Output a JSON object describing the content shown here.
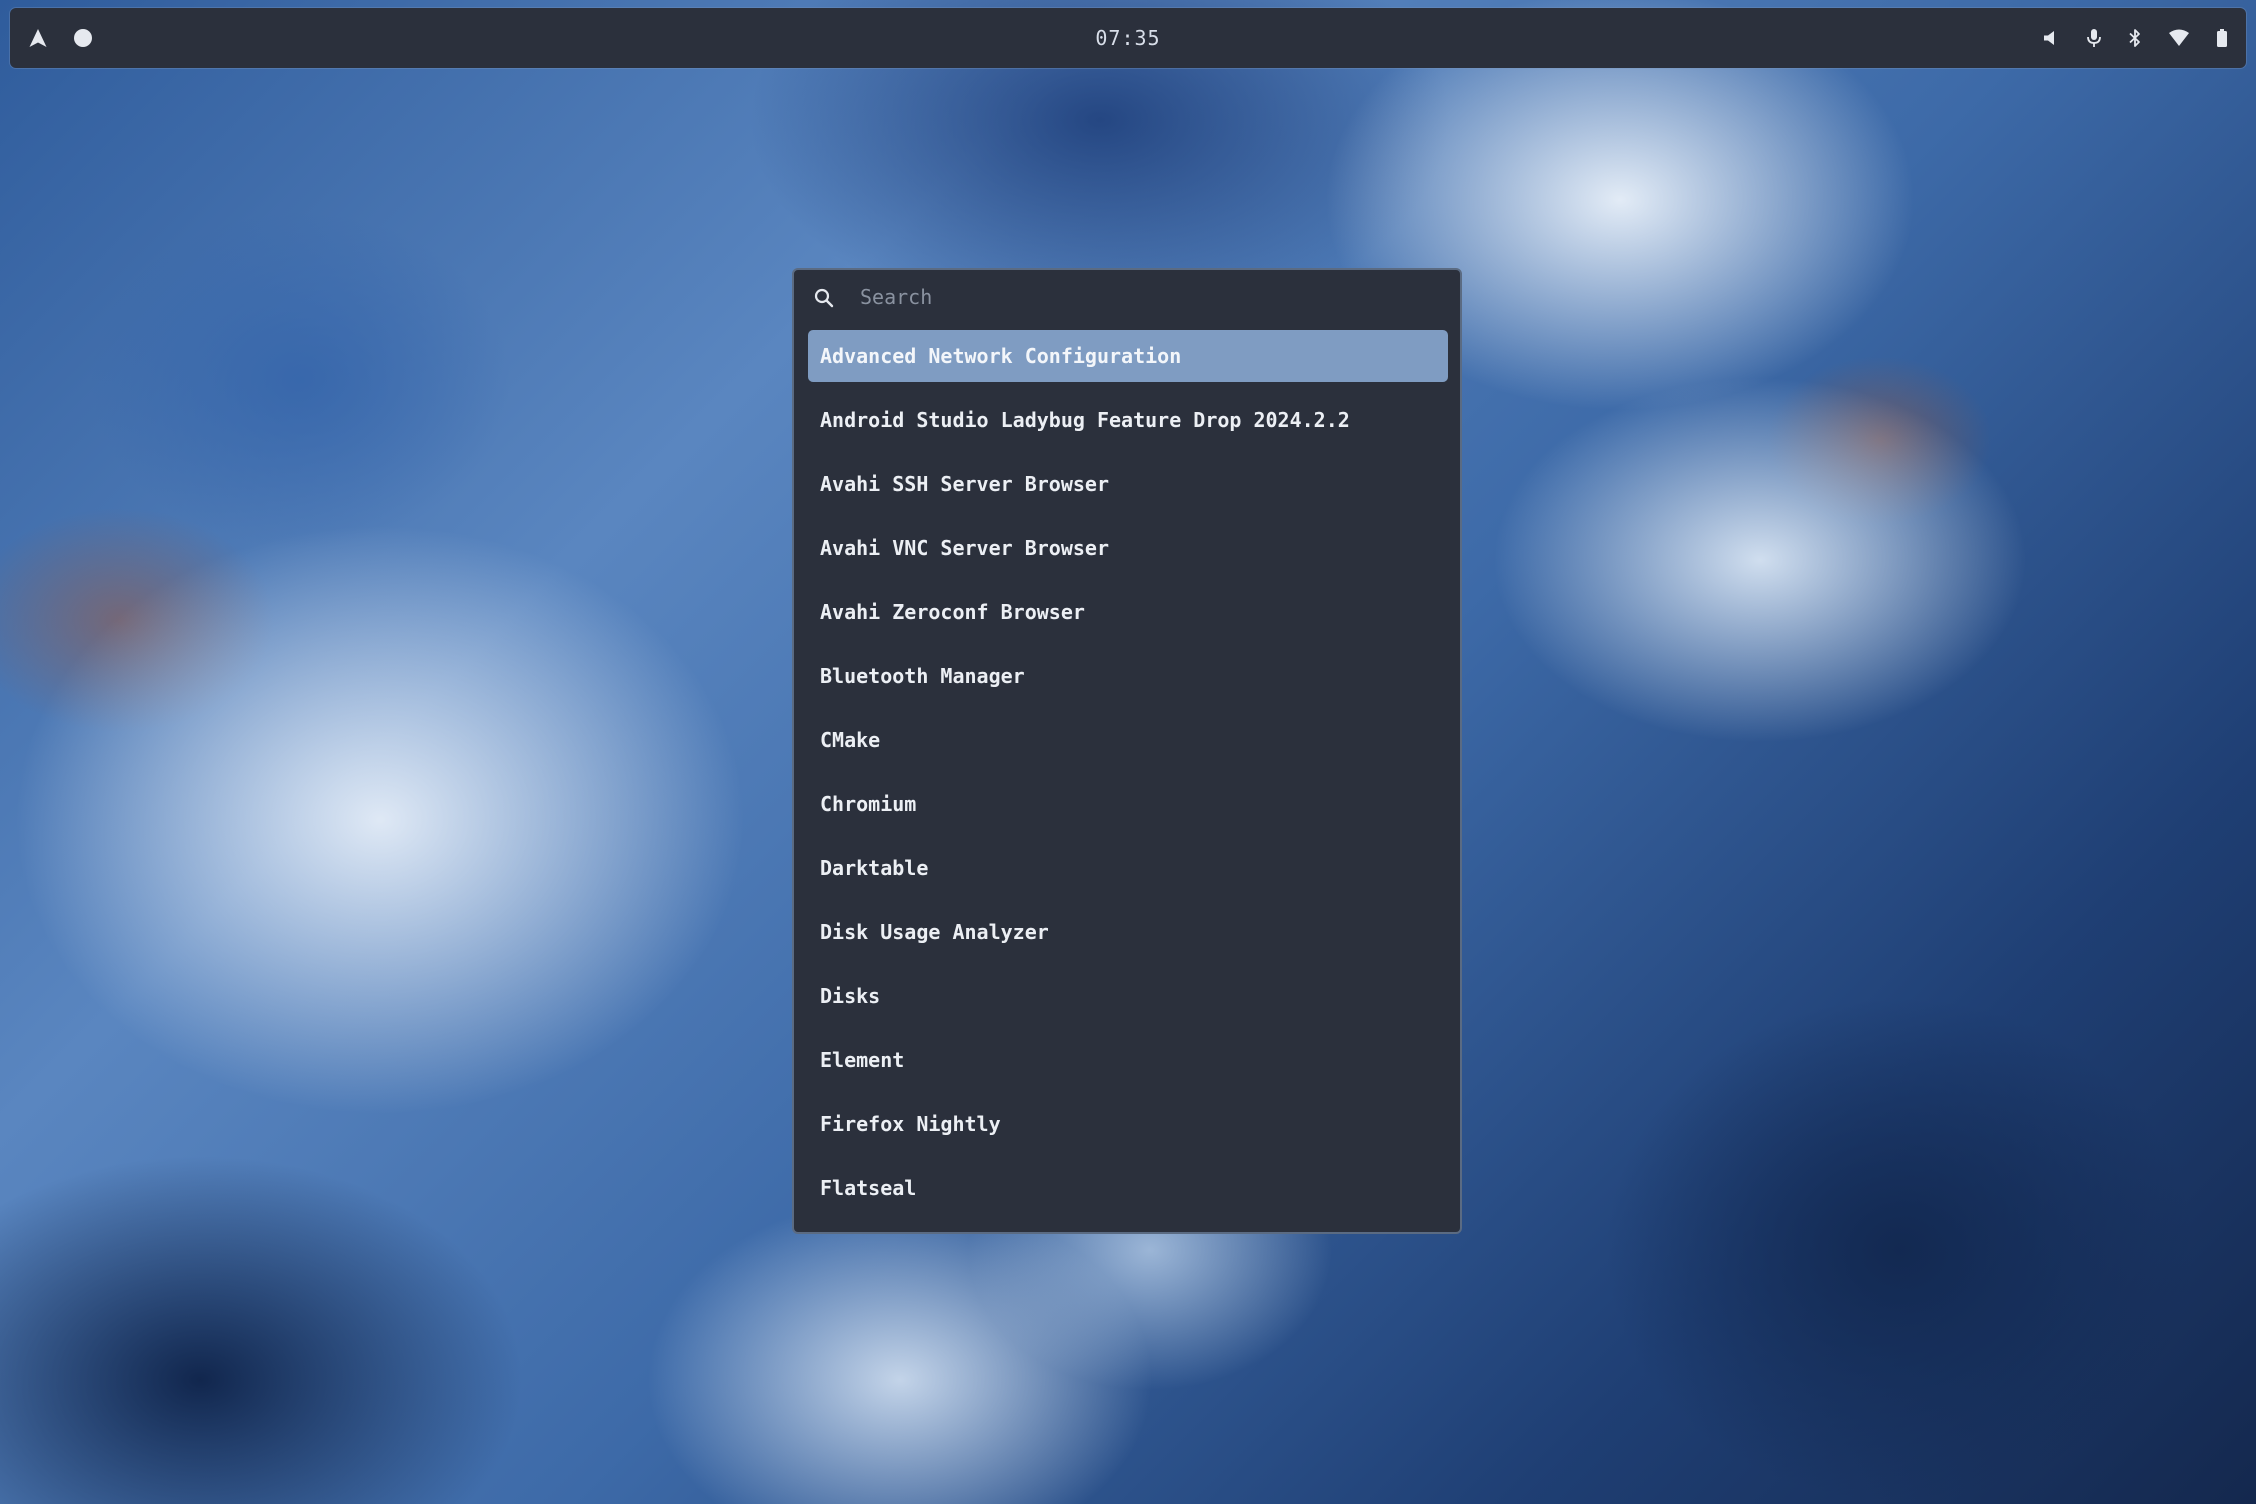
{
  "panel": {
    "clock": "07:35",
    "left_icons": [
      "arch-logo-icon",
      "workspace-dot-icon"
    ],
    "right_icons": [
      "volume-icon",
      "microphone-icon",
      "bluetooth-icon",
      "wifi-icon",
      "battery-icon"
    ]
  },
  "launcher": {
    "search_placeholder": "Search",
    "search_value": "",
    "selected_index": 0,
    "items": [
      {
        "label": "Advanced Network Configuration"
      },
      {
        "label": "Android Studio Ladybug Feature Drop 2024.2.2"
      },
      {
        "label": "Avahi SSH Server Browser"
      },
      {
        "label": "Avahi VNC Server Browser"
      },
      {
        "label": "Avahi Zeroconf Browser"
      },
      {
        "label": "Bluetooth Manager"
      },
      {
        "label": "CMake"
      },
      {
        "label": "Chromium"
      },
      {
        "label": "Darktable"
      },
      {
        "label": "Disk Usage Analyzer"
      },
      {
        "label": "Disks"
      },
      {
        "label": "Element"
      },
      {
        "label": "Firefox Nightly"
      },
      {
        "label": "Flatseal"
      }
    ]
  },
  "colors": {
    "panel_bg": "#2b303c",
    "launcher_bg": "#2b303c",
    "launcher_border": "#5b6b82",
    "selection_bg": "#7f9cc2",
    "text": "#eceff4"
  }
}
